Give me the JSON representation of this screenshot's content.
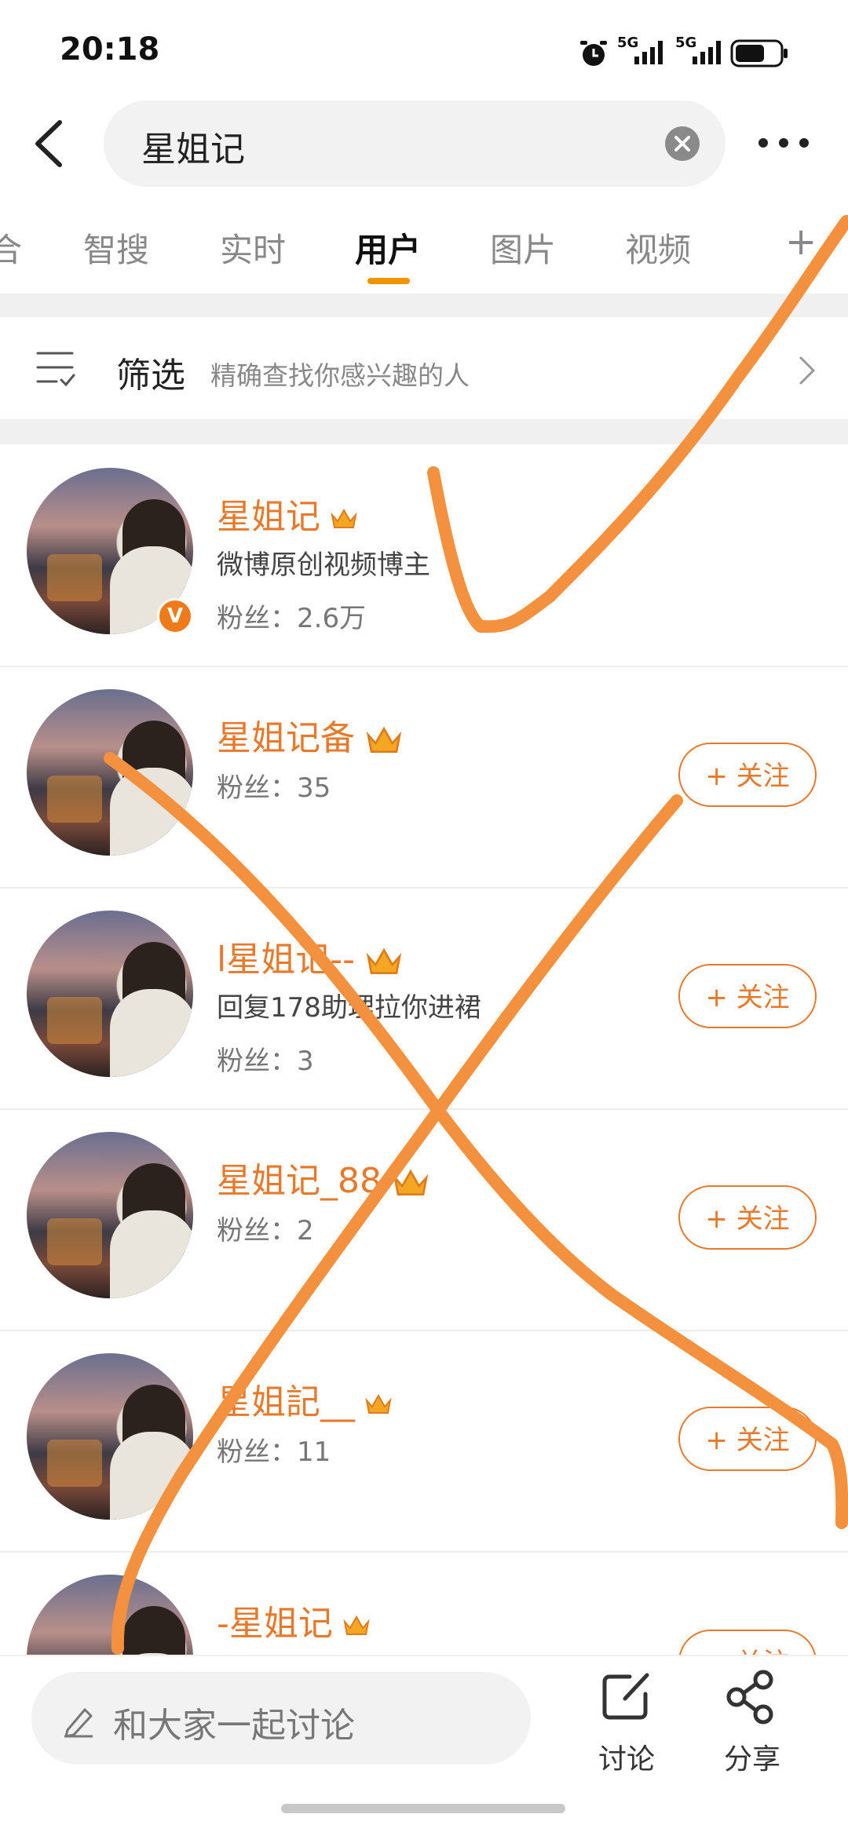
{
  "status_bar": {
    "time": "20:18",
    "signal1": "5G",
    "signal2": "5G"
  },
  "search": {
    "query": "星姐记"
  },
  "tabs": [
    {
      "label": "合",
      "active": false
    },
    {
      "label": "智搜",
      "active": false
    },
    {
      "label": "实时",
      "active": false
    },
    {
      "label": "用户",
      "active": true
    },
    {
      "label": "图片",
      "active": false
    },
    {
      "label": "视频",
      "active": false
    },
    {
      "label": "+",
      "active": false
    }
  ],
  "filter": {
    "label": "筛选",
    "description": "精确查找你感兴趣的人"
  },
  "users": [
    {
      "name": "星姐记",
      "desc": "微博原创视频博主",
      "fans": "粉丝：2.6万",
      "verified": true,
      "follow": ""
    },
    {
      "name": "星姐记备",
      "desc": "",
      "fans": "粉丝：35",
      "verified": false,
      "follow": "+ 关注"
    },
    {
      "name": "l星姐记--",
      "desc": "回复178助理拉你进裙",
      "fans": "粉丝：3",
      "verified": false,
      "follow": "+ 关注"
    },
    {
      "name": "星姐记_88",
      "desc": "",
      "fans": "粉丝：2",
      "verified": false,
      "follow": "+ 关注"
    },
    {
      "name": "星姐記__",
      "desc": "",
      "fans": "粉丝：11",
      "verified": false,
      "follow": "+ 关注"
    },
    {
      "name": "-星姐记",
      "desc": "",
      "fans": "",
      "verified": false,
      "follow": "+ 关注"
    }
  ],
  "bottom_bar": {
    "placeholder": "和大家一起讨论",
    "discuss_label": "讨论",
    "share_label": "分享"
  },
  "colors": {
    "accent": "#e8792a",
    "tab_indicator": "#f29400",
    "scribble": "#f3913f"
  }
}
